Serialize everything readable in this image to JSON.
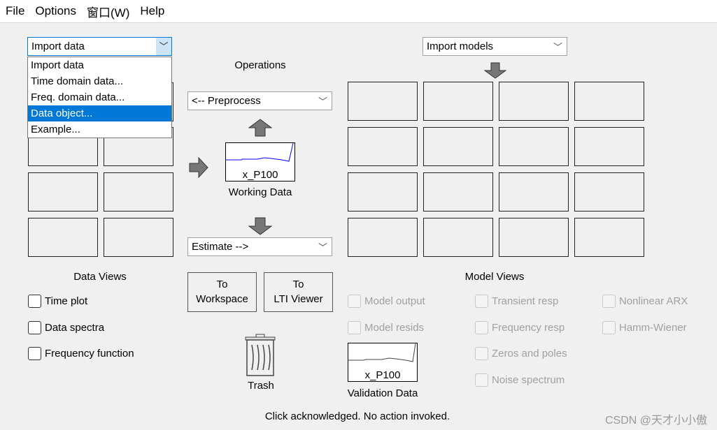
{
  "menu": [
    "File",
    "Options",
    "窗口(W)",
    "Help"
  ],
  "import_data": {
    "value": "Import data",
    "options": [
      "Import data",
      "Time domain data...",
      "Freq. domain data...",
      "Data object...",
      "Example..."
    ],
    "highlighted": "Data object..."
  },
  "import_models": {
    "value": "Import models"
  },
  "operations": {
    "title": "Operations",
    "preprocess": "<-- Preprocess",
    "estimate": "Estimate -->"
  },
  "working_data": {
    "name": "x_P100",
    "label": "Working Data",
    "line_color": "#0000ff"
  },
  "validation_data": {
    "name": "x_P100",
    "label": "Validation Data",
    "line_color": "#444444"
  },
  "buttons": {
    "to_workspace": [
      "To",
      "Workspace"
    ],
    "to_lti": [
      "To",
      "LTI Viewer"
    ]
  },
  "trash": "Trash",
  "data_views": {
    "title": "Data Views",
    "items": [
      "Time plot",
      "Data spectra",
      "Frequency function"
    ]
  },
  "model_views": {
    "title": "Model Views",
    "items": [
      "Model output",
      "Model resids",
      "Transient resp",
      "Frequency resp",
      "Zeros and poles",
      "Noise spectrum",
      "Nonlinear ARX",
      "Hamm-Wiener"
    ]
  },
  "status": "Click acknowledged. No action invoked.",
  "watermark": "CSDN @天才小小傲",
  "accent": "#0078d7"
}
